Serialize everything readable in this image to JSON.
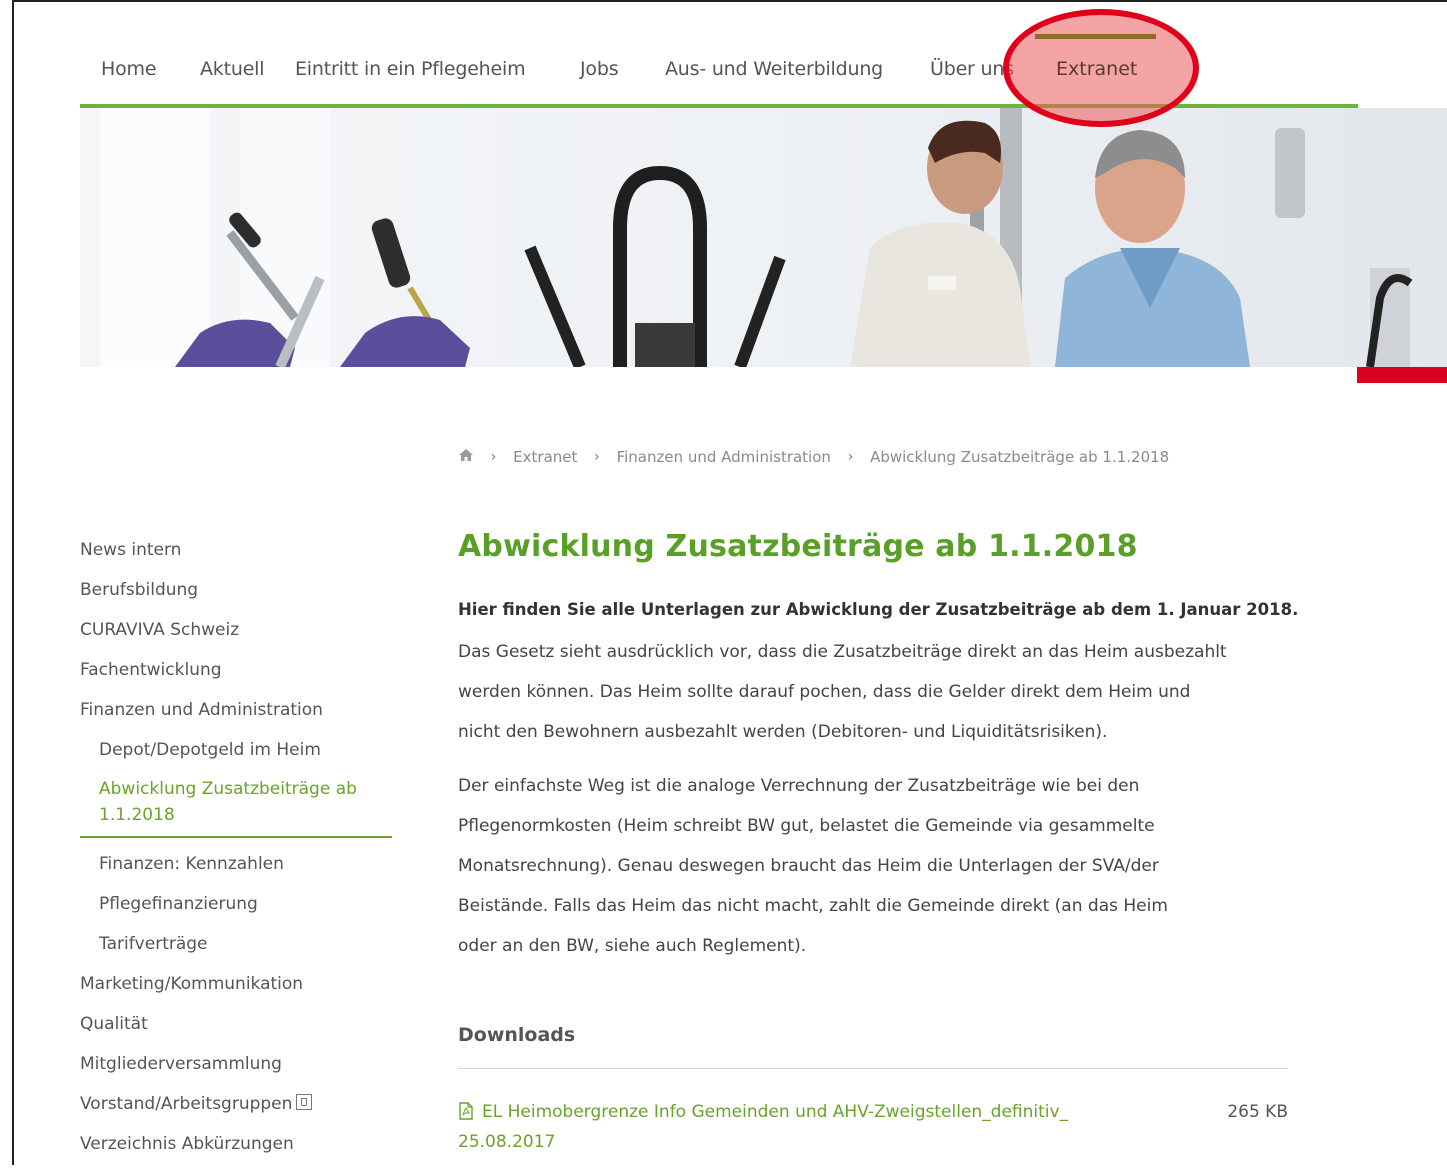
{
  "topnav": {
    "items": [
      {
        "label": "Home"
      },
      {
        "label": "Aktuell"
      },
      {
        "label": "Eintritt in ein Pflegeheim"
      },
      {
        "label": "Jobs"
      },
      {
        "label": "Aus- und Weiterbildung"
      },
      {
        "label": "Über uns"
      },
      {
        "label": "Extranet"
      }
    ],
    "active": "Extranet"
  },
  "breadcrumb": {
    "items": [
      "Extranet",
      "Finanzen und Administration",
      "Abwicklung Zusatzbeiträge ab 1.1.2018"
    ],
    "home_icon": "home-icon",
    "separator": "›"
  },
  "sidebar": {
    "items": [
      {
        "label": "News intern"
      },
      {
        "label": "Berufsbildung"
      },
      {
        "label": "CURAVIVA Schweiz"
      },
      {
        "label": "Fachentwicklung"
      },
      {
        "label": "Finanzen und Administration"
      },
      {
        "label": "Depot/Depotgeld im Heim"
      },
      {
        "label": "Abwicklung Zusatzbeiträge ab 1.1.2018"
      },
      {
        "label": "Finanzen: Kennzahlen"
      },
      {
        "label": "Pflegefinanzierung"
      },
      {
        "label": "Tarifverträge"
      },
      {
        "label": "Marketing/Kommunikation"
      },
      {
        "label": "Qualität"
      },
      {
        "label": "Mitgliederversammlung"
      },
      {
        "label": "Vorstand/Arbeitsgruppen"
      },
      {
        "label": "Verzeichnis Abkürzungen"
      }
    ]
  },
  "main": {
    "title": "Abwicklung Zusatzbeiträge ab 1.1.2018",
    "intro": "Hier finden Sie alle Unterlagen zur Abwicklung der Zusatzbeiträge ab dem 1. Januar 2018.",
    "paragraph1_line1": "Das Gesetz sieht ausdrücklich vor, dass die Zusatzbeiträge direkt an das Heim ausbezahlt",
    "paragraph1_line2": "werden können. Das Heim sollte darauf pochen, dass die Gelder direkt dem Heim und",
    "paragraph1_line3": "nicht den Bewohnern ausbezahlt werden (Debitoren- und Liquiditätsrisiken).",
    "paragraph2_line1": "Der einfachste Weg ist die analoge Verrechnung der Zusatzbeiträge wie bei den",
    "paragraph2_line2": "Pflegenormkosten (Heim schreibt BW gut, belastet die Gemeinde via gesammelte",
    "paragraph2_line3": "Monatsrechnung). Genau deswegen braucht das Heim die Unterlagen der SVA/der",
    "paragraph2_line4": "Beistände. Falls das Heim das nicht macht, zahlt die Gemeinde direkt (an das Heim",
    "paragraph2_line5": "oder an den BW, siehe auch Reglement).",
    "downloads_heading": "Downloads",
    "downloads": [
      {
        "name_line1": "EL Heimobergrenze Info Gemeinden und AHV-Zweigstellen_definitiv_",
        "name_line2": "25.08.2017",
        "size": "265 KB",
        "icon": "pdf-icon"
      }
    ]
  },
  "colors": {
    "accent_green": "#6aa329",
    "nav_underline": "#6db33f",
    "highlight_red": "#e0001a",
    "hero_red_bar": "#d8001c"
  }
}
